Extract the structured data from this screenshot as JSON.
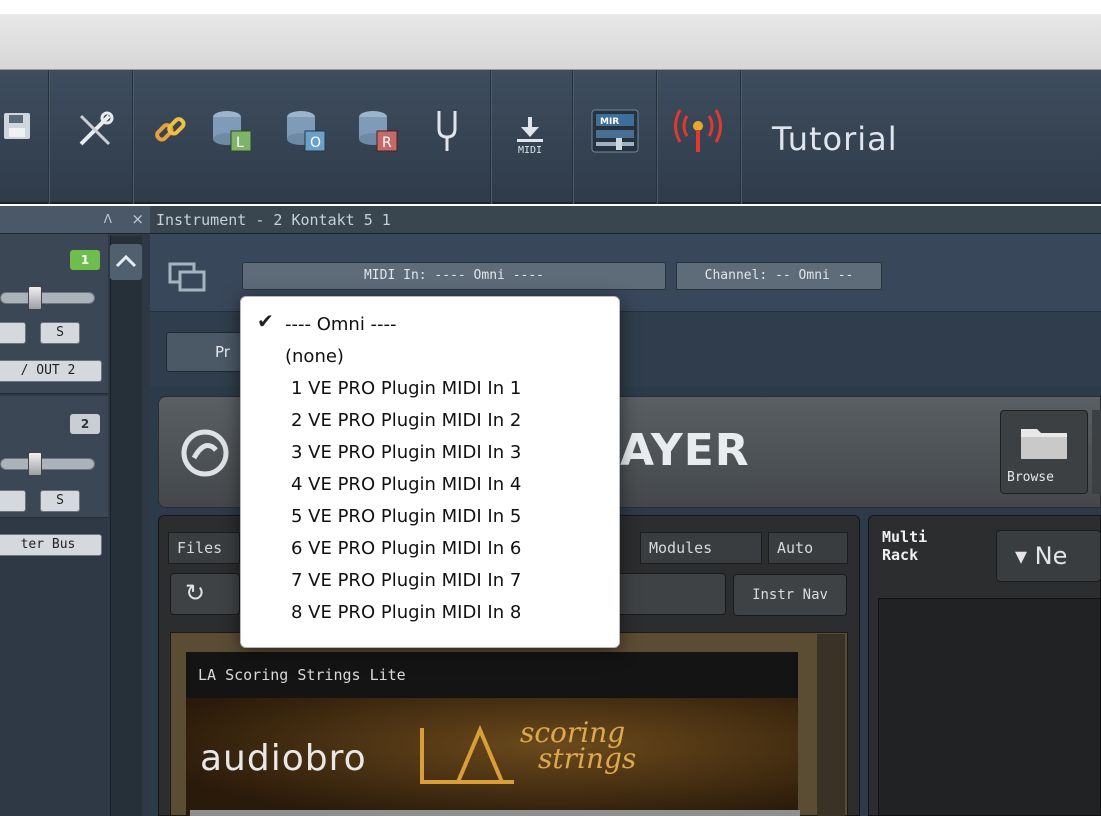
{
  "toolbar": {
    "tutorial_label": "Tutorial",
    "icons": [
      "save-icon",
      "tools-icon",
      "link-icon",
      "database-l-icon",
      "database-o-icon",
      "database-r-icon",
      "tuning-fork-icon",
      "midi-icon",
      "mir-icon",
      "broadcast-icon"
    ],
    "midi_icon_label": "MIDI",
    "mir_icon_label": "MIR",
    "db_labels": [
      "L",
      "O",
      "R"
    ]
  },
  "mixer": {
    "channels": [
      {
        "number": "1",
        "solo_label": "S",
        "output_label": "/ OUT 2"
      },
      {
        "number": "2",
        "solo_label": "S",
        "output_label": "ter Bus"
      }
    ],
    "pin_glyph": "Ʌ",
    "close_glyph": "×",
    "scroll_up_glyph": "^"
  },
  "instrument": {
    "title": "Instrument - 2 Kontakt 5 1",
    "midi_in_label": "MIDI In: ---- Omni ----",
    "channel_label": "Channel: -- Omni --",
    "preset_button_label": "Pr"
  },
  "kontakt": {
    "logo_text": "AYER",
    "browse_label": "Browse",
    "tabs": [
      "Files",
      "Modules",
      "Auto"
    ],
    "instr_nav_label": "Instr Nav",
    "refresh_glyph": "↻",
    "library_title": "LA Scoring Strings Lite",
    "library_brand": "audiobro",
    "library_la": "LA",
    "library_scoring": "scoring",
    "library_strings": "strings",
    "multi_rack_label": "Multi Rack",
    "new_button_label": "▾  Ne"
  },
  "popup_menu": {
    "selected_index": 0,
    "items": [
      "---- Omni ----",
      "(none)",
      "1 VE PRO Plugin MIDI In 1",
      "2 VE PRO Plugin MIDI In 2",
      "3 VE PRO Plugin MIDI In 3",
      "4 VE PRO Plugin MIDI In 4",
      "5 VE PRO Plugin MIDI In 5",
      "6 VE PRO Plugin MIDI In 6",
      "7 VE PRO Plugin MIDI In 7",
      "8 VE PRO Plugin MIDI In 8"
    ],
    "check_glyph": "✔"
  }
}
